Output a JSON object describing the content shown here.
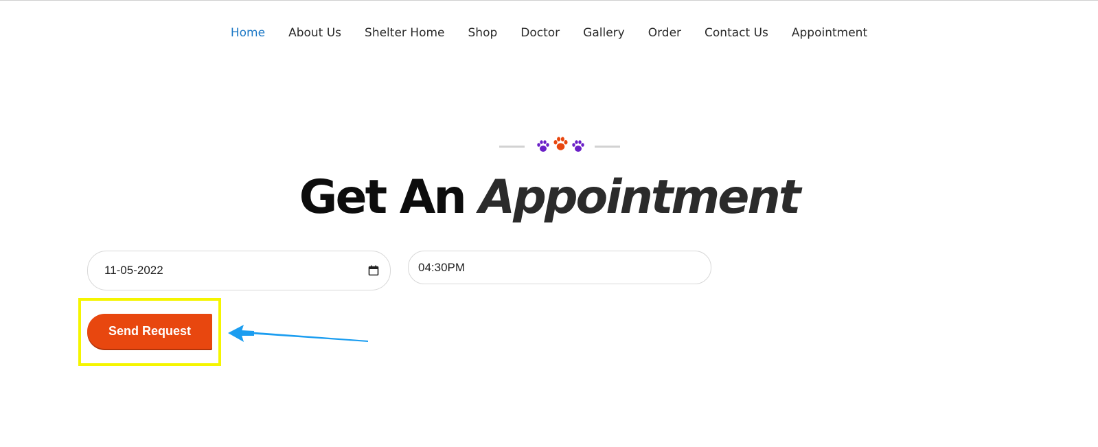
{
  "nav": {
    "items": [
      {
        "label": "Home",
        "active": true
      },
      {
        "label": "About Us",
        "active": false
      },
      {
        "label": "Shelter Home",
        "active": false
      },
      {
        "label": "Shop",
        "active": false
      },
      {
        "label": "Doctor",
        "active": false
      },
      {
        "label": "Gallery",
        "active": false
      },
      {
        "label": "Order",
        "active": false
      },
      {
        "label": "Contact Us",
        "active": false
      },
      {
        "label": "Appointment",
        "active": false
      }
    ]
  },
  "divider": {
    "icons": [
      "paw-icon",
      "paw-icon",
      "paw-icon"
    ],
    "colors": [
      "#6a1fc7",
      "#e8470f",
      "#6a1fc7"
    ]
  },
  "heading": {
    "main": "Get An",
    "accent": "Appointment"
  },
  "form": {
    "date_value": "11-05-2022",
    "time_value": "04:30PM",
    "submit_label": "Send Request"
  },
  "annotation": {
    "highlight_color": "#f5f500",
    "arrow_color": "#1b9df0"
  },
  "colors": {
    "accent": "#e8470f",
    "nav_active": "#1e79c6"
  }
}
